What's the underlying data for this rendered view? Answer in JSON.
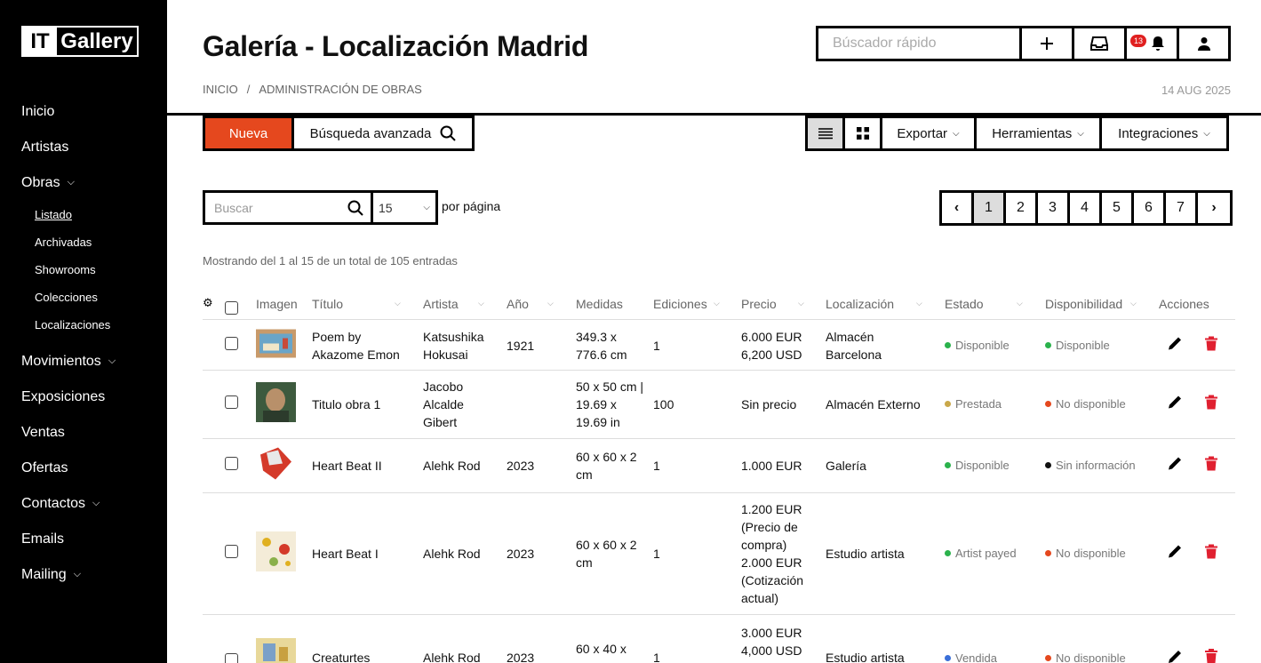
{
  "app": {
    "logo_left": "IT",
    "logo_right": "Gallery"
  },
  "sidebar": {
    "items": [
      {
        "label": "Inicio"
      },
      {
        "label": "Artistas"
      },
      {
        "label": "Obras"
      },
      {
        "label": "Movimientos"
      },
      {
        "label": "Exposiciones"
      },
      {
        "label": "Ventas"
      },
      {
        "label": "Ofertas"
      },
      {
        "label": "Contactos"
      },
      {
        "label": "Emails"
      },
      {
        "label": "Mailing"
      }
    ],
    "sub": [
      {
        "label": "Listado"
      },
      {
        "label": "Archivadas"
      },
      {
        "label": "Showrooms"
      },
      {
        "label": "Colecciones"
      },
      {
        "label": "Localizaciones"
      }
    ]
  },
  "header": {
    "title": "Galería - Localización Madrid",
    "breadcrumb": [
      "INICIO",
      "ADMINISTRACIÓN DE OBRAS"
    ],
    "date": "14 AUG 2025",
    "quick_search_placeholder": "Búscador rápido",
    "notifications_count": "13"
  },
  "toolbar": {
    "new_label": "Nueva",
    "advanced_label": "Búsqueda avanzada",
    "export_label": "Exportar",
    "tools_label": "Herramientas",
    "integrations_label": "Integraciones"
  },
  "filters": {
    "search_placeholder": "Buscar",
    "per_page_value": "15",
    "per_page_label": "por página",
    "showing": "Mostrando del 1 al 15 de un total de 105 entradas"
  },
  "pagination": {
    "pages": [
      "1",
      "2",
      "3",
      "4",
      "5",
      "6",
      "7"
    ],
    "current": "1"
  },
  "table": {
    "headers": {
      "image": "Imagen",
      "title": "Título",
      "artist": "Artista",
      "year": "Año",
      "measures": "Medidas",
      "editions": "Ediciones",
      "price": "Precio",
      "location": "Localización",
      "state": "Estado",
      "availability": "Disponibilidad",
      "actions": "Acciones"
    },
    "rows": [
      {
        "title": "Poem by Akazome Emon",
        "artist": "Katsushika Hokusai",
        "year": "1921",
        "measures": "349.3 x 776.6 cm",
        "editions": "1",
        "price": "6.000 EUR 6,200 USD",
        "location": "Almacén Barcelona",
        "state": "Disponible",
        "state_color": "#2bb24c",
        "availability": "Disponible",
        "avail_color": "#2bb24c"
      },
      {
        "title": "Titulo obra 1",
        "artist": "Jacobo Alcalde Gibert",
        "year": "",
        "measures": "50 x 50 cm | 19.69 x 19.69 in",
        "editions": "100",
        "price": "Sin precio",
        "location": "Almacén Externo",
        "state": "Prestada",
        "state_color": "#c9a84a",
        "availability": "No disponible",
        "avail_color": "#e5481e"
      },
      {
        "title": "Heart Beat II",
        "artist": "Alehk Rod",
        "year": "2023",
        "measures": "60 x 60 x 2 cm",
        "editions": "1",
        "price": "1.000 EUR",
        "location": "Galería",
        "state": "Disponible",
        "state_color": "#2bb24c",
        "availability": "Sin información",
        "avail_color": "#111111"
      },
      {
        "title": "Heart Beat I",
        "artist": "Alehk Rod",
        "year": "2023",
        "measures": "60 x 60 x 2 cm",
        "editions": "1",
        "price": "1.200 EUR (Precio de compra) 2.000 EUR (Cotización actual)",
        "location": "Estudio artista",
        "state": "Artist payed",
        "state_color": "#2bb24c",
        "availability": "No disponible",
        "avail_color": "#e5481e"
      },
      {
        "title": "Creaturtes",
        "artist": "Alehk Rod",
        "year": "2023",
        "measures": "60 x 40 x",
        "editions": "1",
        "price": "3.000 EUR 4,000 USD",
        "location": "Estudio artista",
        "state": "Vendida",
        "state_color": "#3a6fd8",
        "availability": "No disponible",
        "avail_color": "#e5481e"
      }
    ]
  }
}
